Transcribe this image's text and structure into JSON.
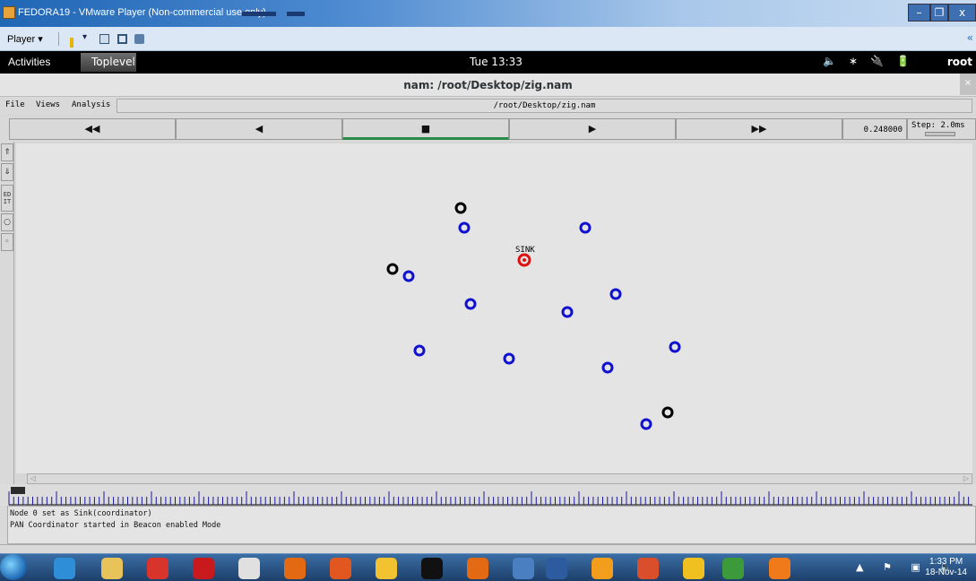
{
  "vm_window": {
    "title": "FEDORA19 - VMware Player (Non-commercial use only)",
    "player_menu": "Player ▾",
    "min_label": "–",
    "max_label": "❐",
    "close_label": "x",
    "right_arrow": "«"
  },
  "gnome": {
    "activities": "Activities",
    "toplevel": "Toplevel",
    "clock": "Tue 13:33",
    "tray_icons": "🔈∗🔌🔋",
    "user": "root"
  },
  "nam": {
    "window_title": "nam: /root/Desktop/zig.nam",
    "close_label": "×",
    "menu": {
      "file": "File",
      "views": "Views",
      "analysis": "Analysis"
    },
    "path": "/root/Desktop/zig.nam",
    "controls": {
      "rewind": "◀◀",
      "back": "◀",
      "stop": "■",
      "play": "▶",
      "fast_forward": "▶▶"
    },
    "time_value": "0.248000",
    "step_label": "Step: 2.0ms",
    "tools": {
      "zoom_in": "⇑",
      "zoom_out": "⇓",
      "edit": "ED IT",
      "circle_big": "○",
      "circle_small": "◦"
    },
    "sink_label": "SINK",
    "log": [
      "Node 0 set as Sink(coordinator)",
      "PAN Coordinator started in Beacon enabled Mode"
    ],
    "colors": {
      "node_blue": "#1010d0",
      "node_black": "#000000",
      "node_red": "#e01010",
      "canvas_bg": "#e4e4e4"
    }
  },
  "taskbar": {
    "time": "1:33 PM",
    "date": "18-Nov-14",
    "tray": "▲ ⚑ ▣ 🔈"
  }
}
